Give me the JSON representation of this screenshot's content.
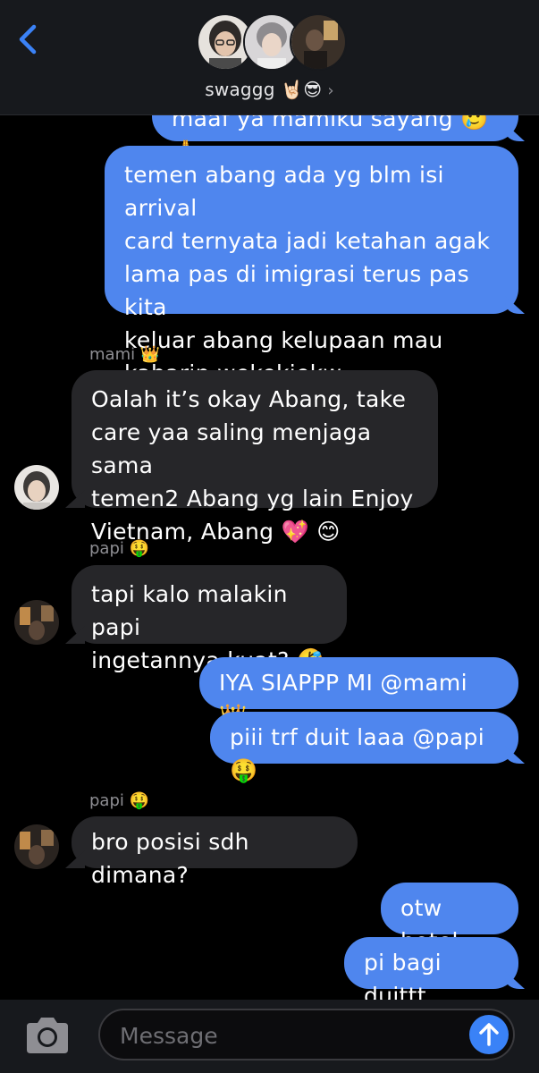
{
  "header": {
    "group_name": "swaggg 🤘🏻😎",
    "chevron": "›",
    "back_icon": "chevron-left-icon"
  },
  "colors": {
    "outgoing_bubble": "#4f86ee",
    "incoming_bubble": "#262629",
    "background": "#000000",
    "accent": "#3a82f7"
  },
  "messages": [
    {
      "from": "me",
      "text": "maaf ya mamiku sayang 🥲🙏"
    },
    {
      "from": "me",
      "lines": [
        "temen abang ada yg blm isi arrival",
        "card ternyata jadi ketahan agak",
        "lama pas di imigrasi terus pas kita",
        "keluar abang kelupaan mau",
        "kabarin wekekjekw"
      ]
    },
    {
      "from": "mami",
      "sender": "mami 👑",
      "lines": [
        "Oalah it’s okay Abang, take",
        "care yaa saling menjaga sama",
        "temen2 Abang yg lain Enjoy",
        "Vietnam, Abang 💖 😊"
      ]
    },
    {
      "from": "papi",
      "sender": "papi 🤑",
      "lines": [
        "tapi kalo malakin papi",
        "ingetannya kuat? 🤣"
      ]
    },
    {
      "from": "me",
      "text": "IYA SIAPPP MI @mami 👑"
    },
    {
      "from": "me",
      "text": "piii trf duit laaa @papi 🤑"
    },
    {
      "from": "papi",
      "sender": "papi 🤑",
      "text": "bro posisi sdh dimana?"
    },
    {
      "from": "me",
      "text": "otw hotel"
    },
    {
      "from": "me",
      "text": "pi bagi duittt"
    }
  ],
  "composer": {
    "placeholder": "Message",
    "camera_icon": "camera-icon",
    "send_icon": "arrow-up-icon"
  }
}
